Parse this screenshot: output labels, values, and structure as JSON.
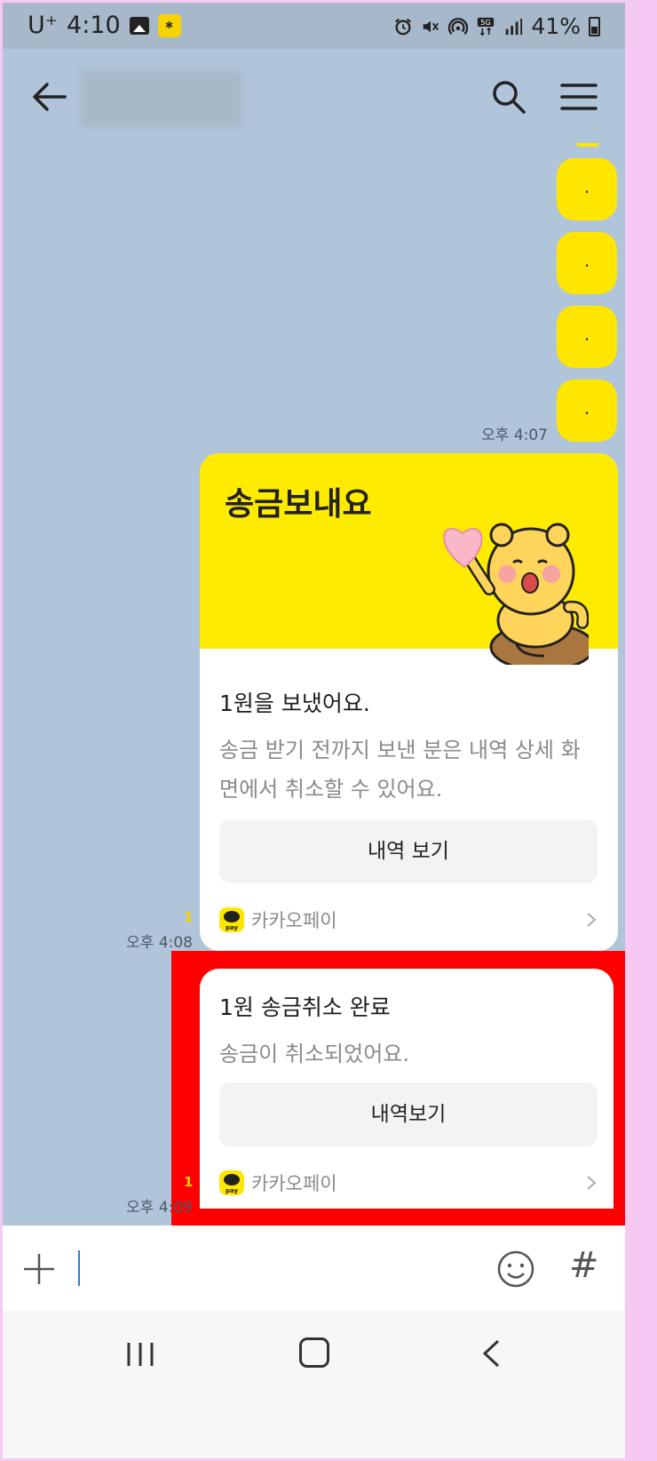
{
  "status_bar": {
    "carrier": "U⁺",
    "time": "4:10",
    "battery": "41%",
    "network": "5G",
    "icons": [
      "gallery-icon",
      "app-icon",
      "alarm-icon",
      "mute-icon",
      "hotspot-icon",
      "5g-icon",
      "signal-icon",
      "battery-icon"
    ]
  },
  "header": {
    "contact_name": "",
    "icons": [
      "back-arrow-icon",
      "search-icon",
      "menu-icon"
    ]
  },
  "messages": {
    "dot_bubbles": [
      ".",
      ".",
      ".",
      "."
    ],
    "time_1": "오후 4:07",
    "unread_1": "1",
    "time_2": "오후 4:08",
    "unread_2": "1",
    "time_3": "오후 4:09"
  },
  "pay_card": {
    "banner_title": "송금보내요",
    "subtitle": "1원을 보냈어요.",
    "description": "송금 받기 전까지 보낸 분은 내역 상세 화면에서 취소할 수 있어요.",
    "button": "내역 보기",
    "brand": "카카오페이",
    "logo_text": "pay"
  },
  "cancel_card": {
    "title": "1원 송금취소 완료",
    "description": "송금이 취소되었어요.",
    "button": "내역보기",
    "brand": "카카오페이",
    "logo_text": "pay"
  },
  "input_bar": {
    "hash": "#",
    "icons": [
      "plus-icon",
      "emoji-icon"
    ]
  },
  "colors": {
    "chat_background": "#b0c5da",
    "bubble_yellow": "#fee600",
    "highlight_red": "#fe0000"
  }
}
